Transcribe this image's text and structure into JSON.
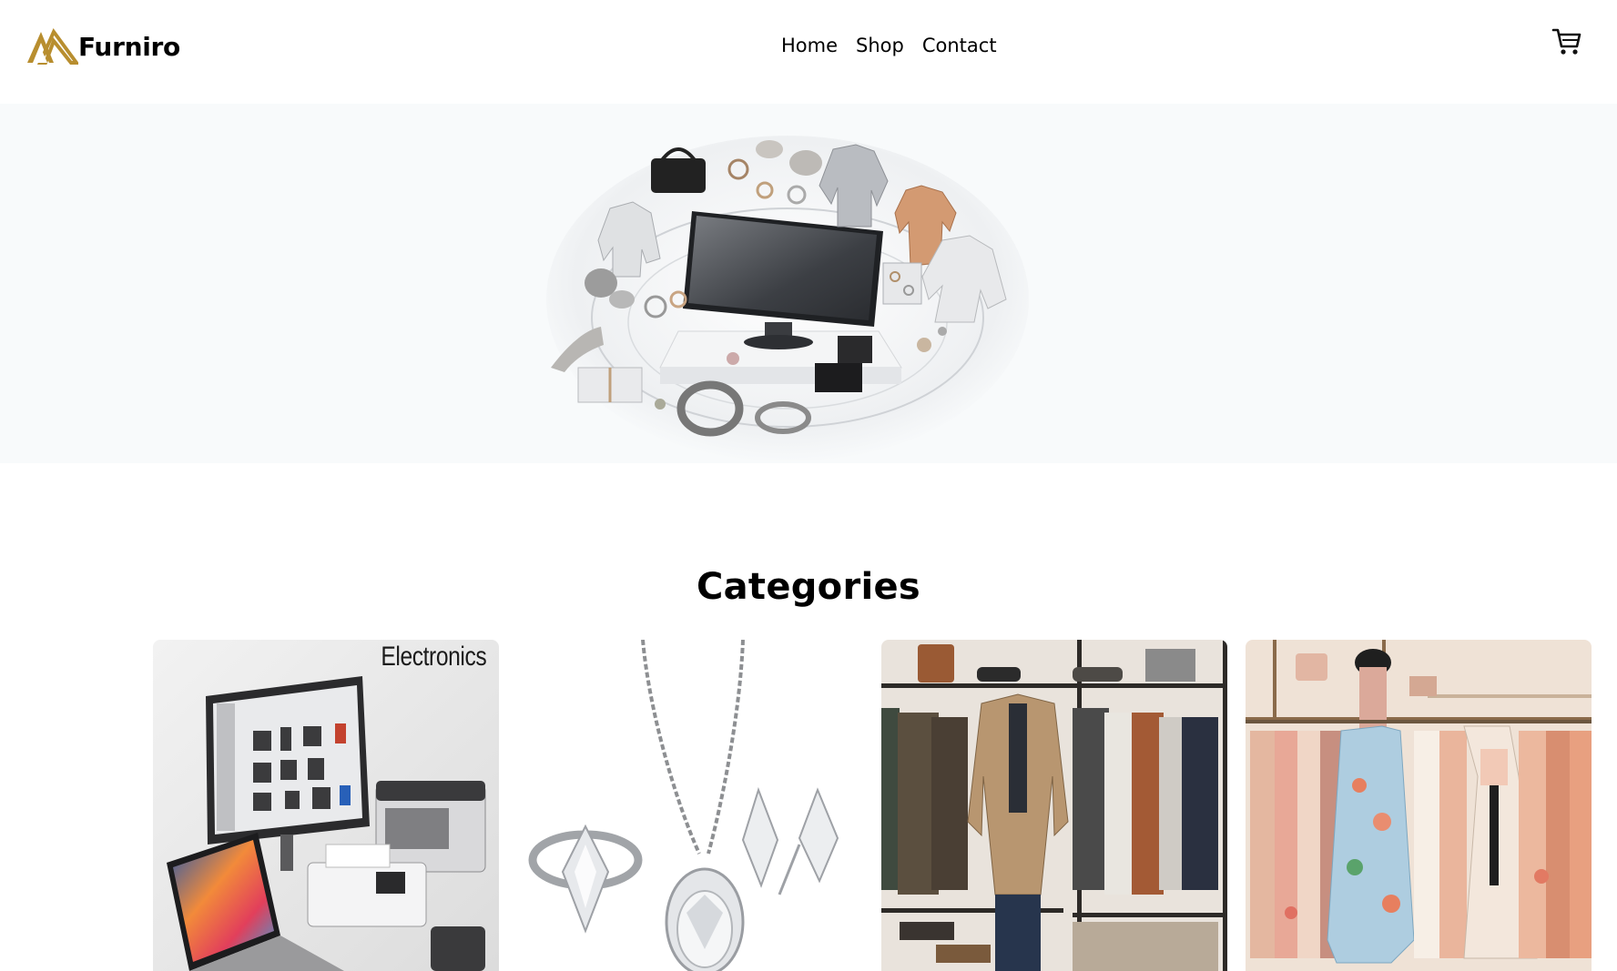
{
  "brand": {
    "name": "Furniro",
    "logo_color": "#b88e2f"
  },
  "nav": {
    "items": [
      "Home",
      "Shop",
      "Contact"
    ]
  },
  "header": {
    "cart_icon": "shopping-cart-icon"
  },
  "hero": {
    "background": "#f8fafb"
  },
  "categories": {
    "title": "Categories",
    "cards": [
      {
        "label": "Electronics",
        "icon": "electronics-photo"
      },
      {
        "label": "",
        "icon": "jewelry-photo"
      },
      {
        "label": "",
        "icon": "mens-clothing-photo"
      },
      {
        "label": "",
        "icon": "womens-clothing-photo"
      }
    ]
  }
}
